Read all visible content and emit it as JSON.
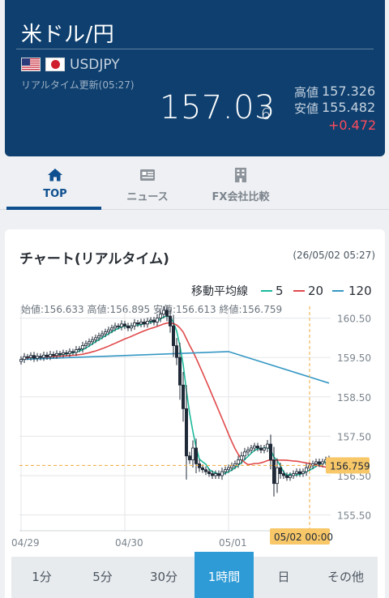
{
  "header": {
    "title": "米ドル/円",
    "symbol": "USDJPY",
    "updated": "リアルタイム更新(05:27)",
    "price_main": "157.03",
    "price_last_digit": "6",
    "high_label": "高値",
    "high_value": "157.326",
    "low_label": "安値",
    "low_value": "155.482",
    "change": "+0.472",
    "flags": [
      "us-flag-icon",
      "jp-flag-icon"
    ]
  },
  "tabs": [
    {
      "label": "TOP",
      "icon": "home-icon",
      "active": true
    },
    {
      "label": "ニュース",
      "icon": "news-icon",
      "active": false
    },
    {
      "label": "FX会社比較",
      "icon": "building-icon",
      "active": false
    }
  ],
  "chart": {
    "title": "チャート(リアルタイム)",
    "timestamp": "(26/05/02 05:27)",
    "ma_label": "移動平均線",
    "ohlc_text": "始値:156.633 高値:156.895 安値:156.613 終値:156.759",
    "current_price_label": "156.759",
    "crosshair_time_label": "05/02 00:00"
  },
  "chart_data": {
    "type": "candlestick",
    "title": "",
    "ylim": [
      155.1,
      160.8
    ],
    "y_ticks": [
      "160.50",
      "159.50",
      "158.50",
      "157.50",
      "156.50",
      "155.50"
    ],
    "y_tick_values": [
      160.5,
      159.5,
      158.5,
      157.5,
      156.5,
      155.5
    ],
    "x_ticks": [
      "04/29",
      "04/30",
      "05/01"
    ],
    "x_tick_index": [
      0,
      32,
      64
    ],
    "candle_count": 96,
    "current_price": 156.759,
    "crosshair_index": 89,
    "closes": [
      159.45,
      159.52,
      159.5,
      159.55,
      159.48,
      159.53,
      159.5,
      159.56,
      159.52,
      159.58,
      159.55,
      159.6,
      159.58,
      159.62,
      159.6,
      159.65,
      159.63,
      159.7,
      159.72,
      159.8,
      159.85,
      159.9,
      159.95,
      160.0,
      160.05,
      160.1,
      160.15,
      160.2,
      160.25,
      160.3,
      160.28,
      160.35,
      160.3,
      160.25,
      160.3,
      160.38,
      160.35,
      160.4,
      160.35,
      160.42,
      160.45,
      160.4,
      160.5,
      160.6,
      160.7,
      160.55,
      160.3,
      159.8,
      159.5,
      158.8,
      158.2,
      157.0,
      156.9,
      157.2,
      156.8,
      156.7,
      156.65,
      156.6,
      156.55,
      156.5,
      156.55,
      156.5,
      156.6,
      156.65,
      156.7,
      156.75,
      156.8,
      156.9,
      157.0,
      157.1,
      157.15,
      157.2,
      157.25,
      157.2,
      157.15,
      157.2,
      157.3,
      156.9,
      156.3,
      156.7,
      156.55,
      156.5,
      156.45,
      156.5,
      156.55,
      156.6,
      156.55,
      156.6,
      156.7,
      156.75,
      156.8,
      156.85,
      156.8,
      156.85,
      156.9,
      156.8
    ],
    "series": [
      {
        "name": "5",
        "color": "#1bb99a"
      },
      {
        "name": "20",
        "color": "#e0494b"
      },
      {
        "name": "120",
        "color": "#3597c4"
      }
    ],
    "ma120": [
      [
        0,
        159.45
      ],
      [
        64,
        159.65
      ],
      [
        96,
        158.85
      ]
    ],
    "grid": true
  },
  "periods": [
    {
      "label": "1分",
      "active": false
    },
    {
      "label": "5分",
      "active": false
    },
    {
      "label": "30分",
      "active": false
    },
    {
      "label": "1時間",
      "active": true
    },
    {
      "label": "日",
      "active": false
    },
    {
      "label": "その他",
      "active": false
    }
  ]
}
